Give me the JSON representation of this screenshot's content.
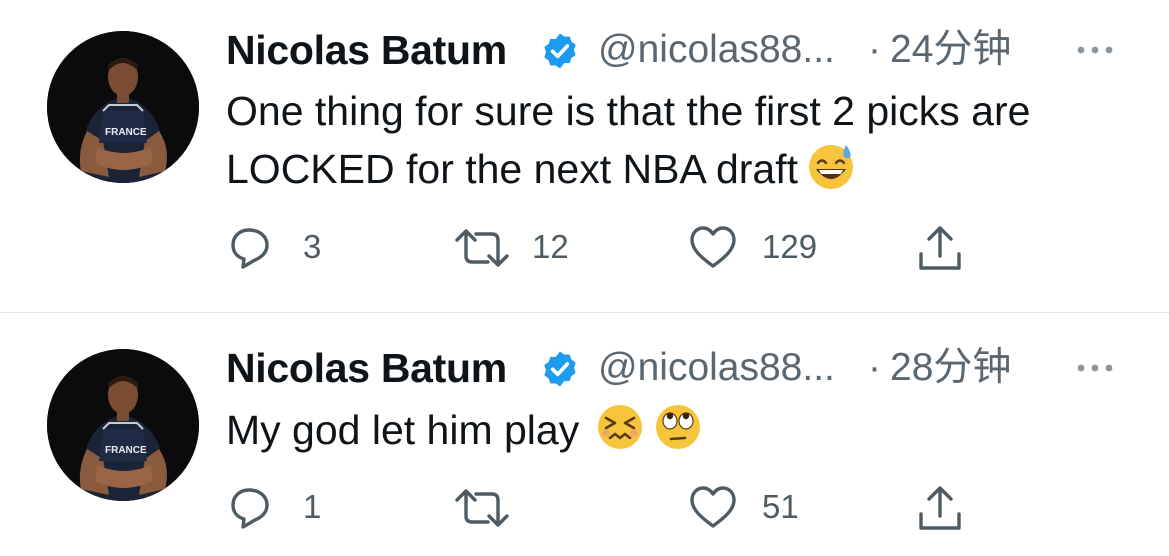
{
  "tweets": [
    {
      "author": "Nicolas Batum",
      "handle": "@nicolas88...",
      "separator": "·",
      "time": "24分钟",
      "text": "One thing for sure is that the first 2 picks are LOCKED for the next NBA draft",
      "emojis": [
        "grinning-sweat-emoji"
      ],
      "replies": "3",
      "retweets": "12",
      "likes": "129",
      "avatar_text": "FRANCE"
    },
    {
      "author": "Nicolas Batum",
      "handle": "@nicolas88...",
      "separator": "·",
      "time": "28分钟",
      "text": "My god let him play",
      "emojis": [
        "confounded-face-emoji",
        "rolling-eyes-emoji"
      ],
      "replies": "1",
      "retweets": "",
      "likes": "51",
      "avatar_text": "FRANCE"
    }
  ],
  "colors": {
    "verified_blue": "#1d9bf0",
    "secondary_text": "#5b6770",
    "divider": "#e6e6e6"
  },
  "icons": [
    "verified-badge-icon",
    "more-icon",
    "reply-icon",
    "retweet-icon",
    "like-icon",
    "share-icon"
  ]
}
